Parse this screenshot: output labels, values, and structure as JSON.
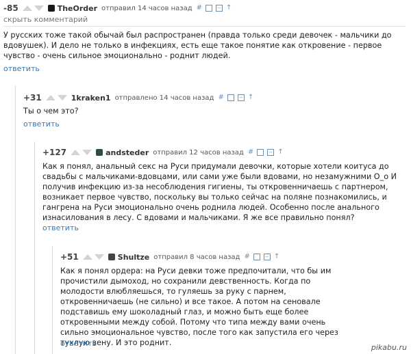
{
  "comments": [
    {
      "rating": "-85",
      "author": "TheOrder",
      "posted": "отправил 14 часов назад",
      "hide_link": "скрыть комментарий",
      "text": "У русских тоже такой обычай был распространен (правда только среди девочек - мальчики до вдовушек). И дело не только в инфекциях, есть еще такое понятие как откровение - первое чувство - очень сильное эмоционально - роднит людей.",
      "reply": "ответить",
      "avatar_color": "#1a1a1a"
    },
    {
      "rating": "+31",
      "author": "1kraken1",
      "posted": "отправлено 14 часов назад",
      "text": "Ты о чем это?",
      "reply": "ответить"
    },
    {
      "rating": "+127",
      "author": "andsteder",
      "posted": "отправил 12 часов назад",
      "text": "Как я понял, анальный секс на Руси придумали девочки, которые хотели коитуса до свадьбы с мальчиками-вдовцами, или сами уже были вдовами, но незамужними О_о И получив инфекцию из-за несоблюдения гигиены, ты откровенничаешь с партнером, возникает первое чувство, поскольку вы только сейчас на поляне познакомились, и гангрена на Руси эмоционально очень роднила людей. Особенно после анального изнасилования в лесу. С вдовами и мальчиками. Я же все правильно понял?",
      "reply": "ответить",
      "avatar_color": "#2f4f3a"
    },
    {
      "rating": "+51",
      "author": "Shultze",
      "posted": "отправил 8 часов назад",
      "text": "Как я понял ордера: на Руси девки тоже предпочитали, что бы им прочистили дымоход, но сохранили девственность. Когда по молодости влюбляешься, то гуляешь за руку с парнем, откровенничаешь (не сильно) и все такое. А потом на сеновале подставишь ему шоколадный глаз, и можно быть еще более откровенными между собой. Потому что типа между вами очень сильно эмоциональное чувство, после того как запустила его через тухлую вену. И это роднит.",
      "reply": "ответить",
      "avatar_color": "#444444"
    }
  ],
  "tool_icons": [
    "hash-icon",
    "save-icon",
    "collapse-icon",
    "parent-arrow-icon"
  ],
  "tool_glyphs": {
    "hash": "#",
    "box1": "",
    "box2": "",
    "up": "↑"
  },
  "watermark": "pikabu.ru"
}
